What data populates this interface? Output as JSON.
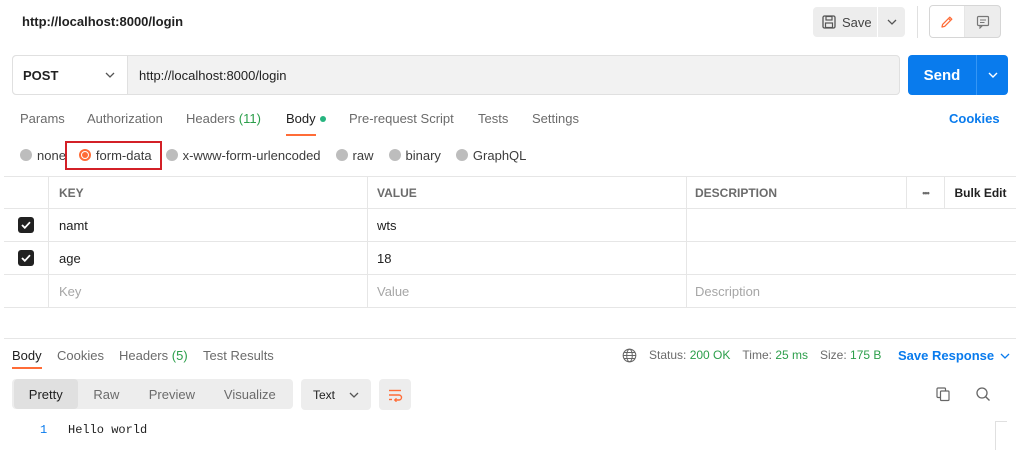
{
  "header": {
    "title": "http://localhost:8000/login",
    "save_label": "Save"
  },
  "request": {
    "method": "POST",
    "url": "http://localhost:8000/login",
    "send_label": "Send"
  },
  "tabs": [
    {
      "label": "Params"
    },
    {
      "label": "Authorization"
    },
    {
      "label": "Headers",
      "count": "(11)"
    },
    {
      "label": "Body",
      "active": true
    },
    {
      "label": "Pre-request Script"
    },
    {
      "label": "Tests"
    },
    {
      "label": "Settings"
    }
  ],
  "cookies_label": "Cookies",
  "body_types": [
    {
      "label": "none"
    },
    {
      "label": "form-data",
      "selected": true
    },
    {
      "label": "x-www-form-urlencoded"
    },
    {
      "label": "raw"
    },
    {
      "label": "binary"
    },
    {
      "label": "GraphQL"
    }
  ],
  "table": {
    "headers": {
      "key": "KEY",
      "value": "VALUE",
      "description": "DESCRIPTION",
      "more": "•••",
      "bulk_edit": "Bulk Edit"
    },
    "rows": [
      {
        "checked": true,
        "key": "namt",
        "value": "wts",
        "description": ""
      },
      {
        "checked": true,
        "key": "age",
        "value": "18",
        "description": ""
      }
    ],
    "placeholders": {
      "key": "Key",
      "value": "Value",
      "description": "Description"
    }
  },
  "response": {
    "tabs": [
      {
        "label": "Body",
        "active": true
      },
      {
        "label": "Cookies"
      },
      {
        "label": "Headers",
        "count": "(5)"
      },
      {
        "label": "Test Results"
      }
    ],
    "status_label": "Status:",
    "status_value": "200 OK",
    "time_label": "Time:",
    "time_value": "25 ms",
    "size_label": "Size:",
    "size_value": "175 B",
    "save_response_label": "Save Response",
    "view_tabs": [
      {
        "label": "Pretty",
        "active": true
      },
      {
        "label": "Raw"
      },
      {
        "label": "Preview"
      },
      {
        "label": "Visualize"
      }
    ],
    "format": "Text",
    "lines": [
      {
        "num": "1",
        "text": "Hello world"
      }
    ]
  },
  "colors": {
    "accent_orange": "#ff6c37",
    "primary_blue": "#097bed",
    "success_green": "#2b9e4a",
    "highlight_red": "#d32027"
  },
  "icons": [
    "floppy-disk-icon",
    "chevron-down-icon",
    "pencil-icon",
    "comment-icon",
    "globe-icon",
    "wrap-lines-icon",
    "copy-icon",
    "search-icon",
    "checkbox-checked-icon"
  ]
}
